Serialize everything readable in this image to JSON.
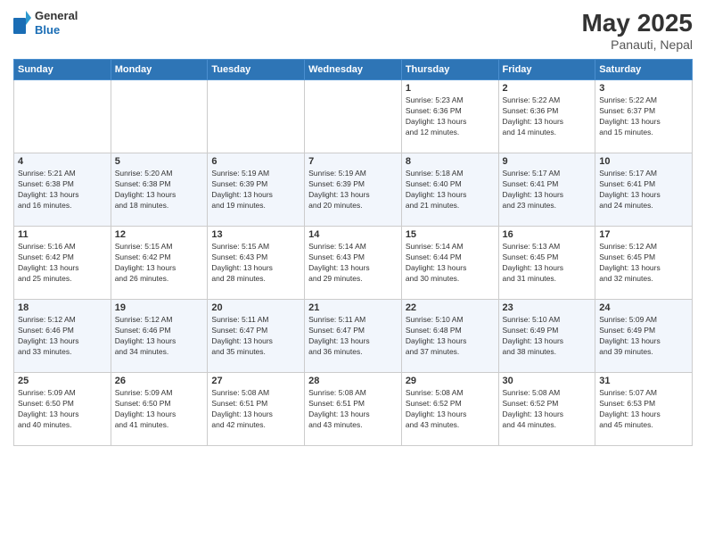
{
  "header": {
    "logo_general": "General",
    "logo_blue": "Blue",
    "month": "May 2025",
    "location": "Panauti, Nepal"
  },
  "days_of_week": [
    "Sunday",
    "Monday",
    "Tuesday",
    "Wednesday",
    "Thursday",
    "Friday",
    "Saturday"
  ],
  "weeks": [
    [
      {
        "day": "",
        "info": ""
      },
      {
        "day": "",
        "info": ""
      },
      {
        "day": "",
        "info": ""
      },
      {
        "day": "",
        "info": ""
      },
      {
        "day": "1",
        "info": "Sunrise: 5:23 AM\nSunset: 6:36 PM\nDaylight: 13 hours\nand 12 minutes."
      },
      {
        "day": "2",
        "info": "Sunrise: 5:22 AM\nSunset: 6:36 PM\nDaylight: 13 hours\nand 14 minutes."
      },
      {
        "day": "3",
        "info": "Sunrise: 5:22 AM\nSunset: 6:37 PM\nDaylight: 13 hours\nand 15 minutes."
      }
    ],
    [
      {
        "day": "4",
        "info": "Sunrise: 5:21 AM\nSunset: 6:38 PM\nDaylight: 13 hours\nand 16 minutes."
      },
      {
        "day": "5",
        "info": "Sunrise: 5:20 AM\nSunset: 6:38 PM\nDaylight: 13 hours\nand 18 minutes."
      },
      {
        "day": "6",
        "info": "Sunrise: 5:19 AM\nSunset: 6:39 PM\nDaylight: 13 hours\nand 19 minutes."
      },
      {
        "day": "7",
        "info": "Sunrise: 5:19 AM\nSunset: 6:39 PM\nDaylight: 13 hours\nand 20 minutes."
      },
      {
        "day": "8",
        "info": "Sunrise: 5:18 AM\nSunset: 6:40 PM\nDaylight: 13 hours\nand 21 minutes."
      },
      {
        "day": "9",
        "info": "Sunrise: 5:17 AM\nSunset: 6:41 PM\nDaylight: 13 hours\nand 23 minutes."
      },
      {
        "day": "10",
        "info": "Sunrise: 5:17 AM\nSunset: 6:41 PM\nDaylight: 13 hours\nand 24 minutes."
      }
    ],
    [
      {
        "day": "11",
        "info": "Sunrise: 5:16 AM\nSunset: 6:42 PM\nDaylight: 13 hours\nand 25 minutes."
      },
      {
        "day": "12",
        "info": "Sunrise: 5:15 AM\nSunset: 6:42 PM\nDaylight: 13 hours\nand 26 minutes."
      },
      {
        "day": "13",
        "info": "Sunrise: 5:15 AM\nSunset: 6:43 PM\nDaylight: 13 hours\nand 28 minutes."
      },
      {
        "day": "14",
        "info": "Sunrise: 5:14 AM\nSunset: 6:43 PM\nDaylight: 13 hours\nand 29 minutes."
      },
      {
        "day": "15",
        "info": "Sunrise: 5:14 AM\nSunset: 6:44 PM\nDaylight: 13 hours\nand 30 minutes."
      },
      {
        "day": "16",
        "info": "Sunrise: 5:13 AM\nSunset: 6:45 PM\nDaylight: 13 hours\nand 31 minutes."
      },
      {
        "day": "17",
        "info": "Sunrise: 5:12 AM\nSunset: 6:45 PM\nDaylight: 13 hours\nand 32 minutes."
      }
    ],
    [
      {
        "day": "18",
        "info": "Sunrise: 5:12 AM\nSunset: 6:46 PM\nDaylight: 13 hours\nand 33 minutes."
      },
      {
        "day": "19",
        "info": "Sunrise: 5:12 AM\nSunset: 6:46 PM\nDaylight: 13 hours\nand 34 minutes."
      },
      {
        "day": "20",
        "info": "Sunrise: 5:11 AM\nSunset: 6:47 PM\nDaylight: 13 hours\nand 35 minutes."
      },
      {
        "day": "21",
        "info": "Sunrise: 5:11 AM\nSunset: 6:47 PM\nDaylight: 13 hours\nand 36 minutes."
      },
      {
        "day": "22",
        "info": "Sunrise: 5:10 AM\nSunset: 6:48 PM\nDaylight: 13 hours\nand 37 minutes."
      },
      {
        "day": "23",
        "info": "Sunrise: 5:10 AM\nSunset: 6:49 PM\nDaylight: 13 hours\nand 38 minutes."
      },
      {
        "day": "24",
        "info": "Sunrise: 5:09 AM\nSunset: 6:49 PM\nDaylight: 13 hours\nand 39 minutes."
      }
    ],
    [
      {
        "day": "25",
        "info": "Sunrise: 5:09 AM\nSunset: 6:50 PM\nDaylight: 13 hours\nand 40 minutes."
      },
      {
        "day": "26",
        "info": "Sunrise: 5:09 AM\nSunset: 6:50 PM\nDaylight: 13 hours\nand 41 minutes."
      },
      {
        "day": "27",
        "info": "Sunrise: 5:08 AM\nSunset: 6:51 PM\nDaylight: 13 hours\nand 42 minutes."
      },
      {
        "day": "28",
        "info": "Sunrise: 5:08 AM\nSunset: 6:51 PM\nDaylight: 13 hours\nand 43 minutes."
      },
      {
        "day": "29",
        "info": "Sunrise: 5:08 AM\nSunset: 6:52 PM\nDaylight: 13 hours\nand 43 minutes."
      },
      {
        "day": "30",
        "info": "Sunrise: 5:08 AM\nSunset: 6:52 PM\nDaylight: 13 hours\nand 44 minutes."
      },
      {
        "day": "31",
        "info": "Sunrise: 5:07 AM\nSunset: 6:53 PM\nDaylight: 13 hours\nand 45 minutes."
      }
    ]
  ]
}
